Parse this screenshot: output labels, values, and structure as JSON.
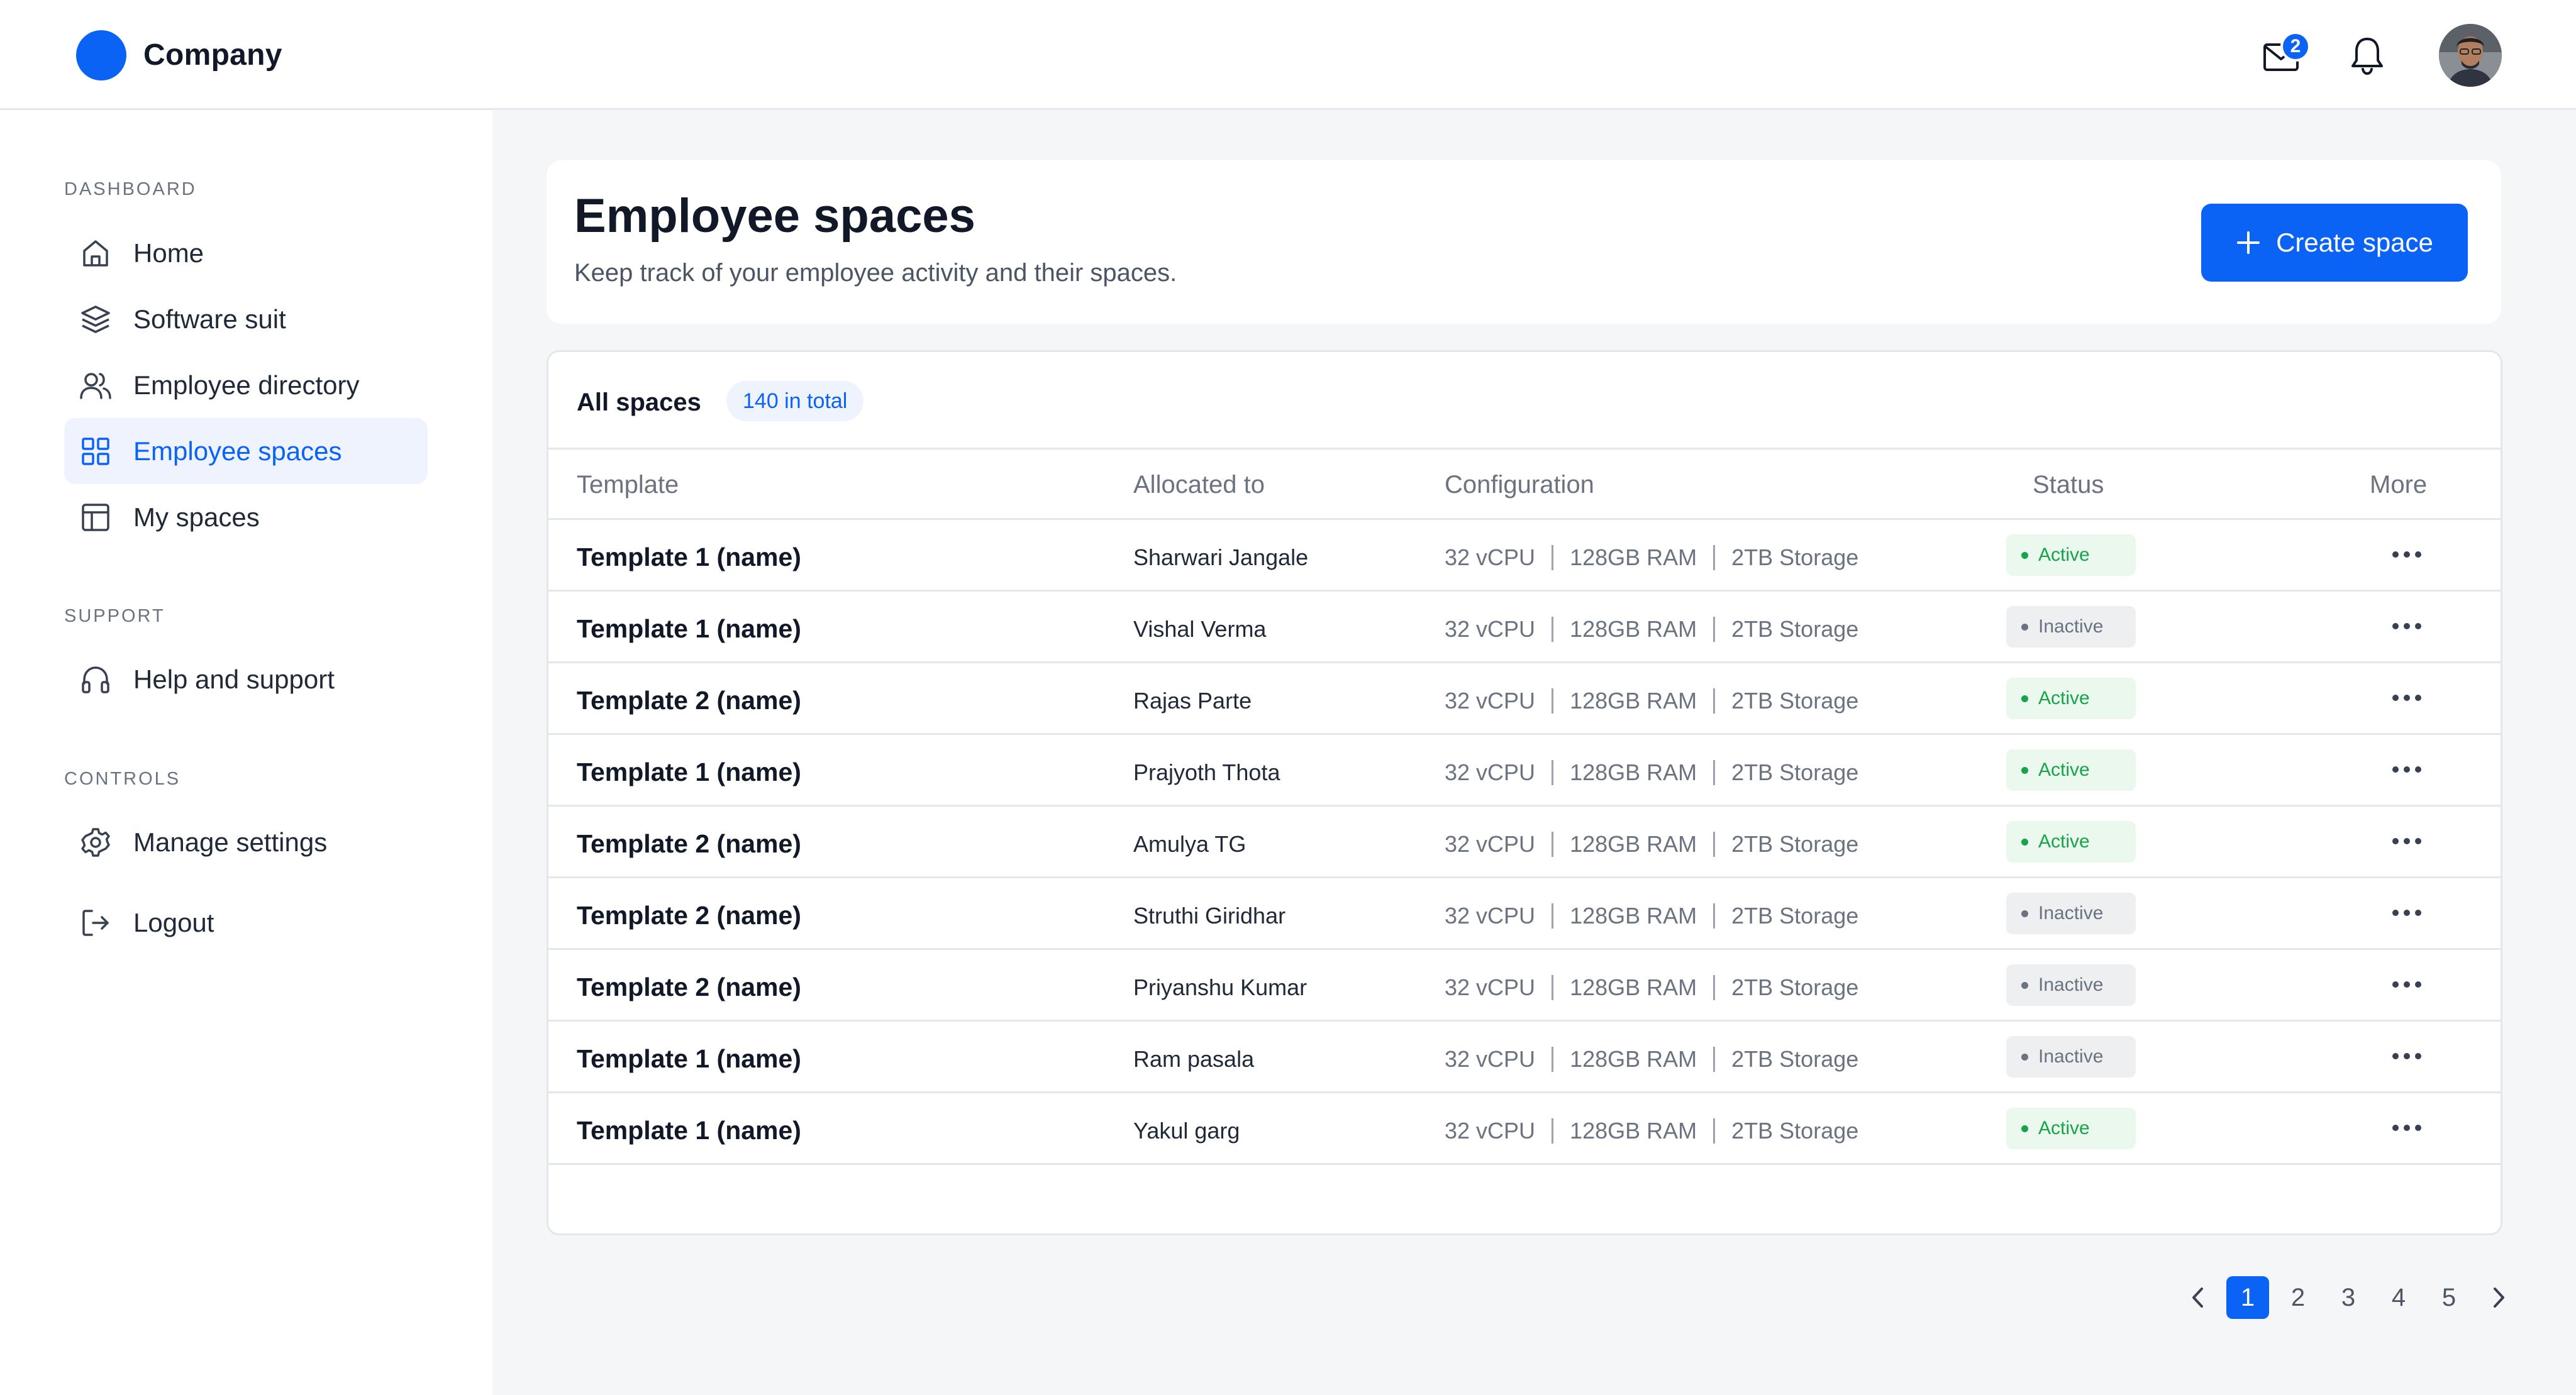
{
  "brand": {
    "name": "Company",
    "logo_color": "#0b63f6"
  },
  "topbar": {
    "mail_badge": "2"
  },
  "sidebar": {
    "sections": {
      "dashboard": "DASHBOARD",
      "support": "SUPPORT",
      "controls": "CONTROLS"
    },
    "items": [
      {
        "label": "Home",
        "icon": "home-icon"
      },
      {
        "label": "Software suit",
        "icon": "layers-icon"
      },
      {
        "label": "Employee directory",
        "icon": "users-icon"
      },
      {
        "label": "Employee spaces",
        "icon": "grid-icon",
        "active": true
      },
      {
        "label": "My spaces",
        "icon": "layout-icon"
      },
      {
        "label": "Help and support",
        "icon": "headphones-icon"
      },
      {
        "label": "Manage settings",
        "icon": "gear-icon"
      },
      {
        "label": "Logout",
        "icon": "logout-icon"
      }
    ]
  },
  "page": {
    "title": "Employee spaces",
    "subtitle": "Keep track of your employee activity and their spaces.",
    "create_label": "Create space"
  },
  "table": {
    "title": "All spaces",
    "total": "140 in total",
    "columns": [
      "Template",
      "Allocated to",
      "Configuration",
      "Status",
      "More"
    ],
    "rows": [
      {
        "template": "Template 1 (name)",
        "allocated": "Sharwari Jangale",
        "cpu": "32 vCPU",
        "ram": "128GB RAM",
        "storage": "2TB Storage",
        "status": "Active"
      },
      {
        "template": "Template 1 (name)",
        "allocated": "Vishal Verma",
        "cpu": "32 vCPU",
        "ram": "128GB RAM",
        "storage": "2TB Storage",
        "status": "Inactive"
      },
      {
        "template": "Template 2 (name)",
        "allocated": "Rajas Parte",
        "cpu": "32 vCPU",
        "ram": "128GB RAM",
        "storage": "2TB Storage",
        "status": "Active"
      },
      {
        "template": "Template 1 (name)",
        "allocated": "Prajyoth Thota",
        "cpu": "32 vCPU",
        "ram": "128GB RAM",
        "storage": "2TB Storage",
        "status": "Active"
      },
      {
        "template": "Template 2 (name)",
        "allocated": "Amulya TG",
        "cpu": "32 vCPU",
        "ram": "128GB RAM",
        "storage": "2TB Storage",
        "status": "Active"
      },
      {
        "template": "Template 2 (name)",
        "allocated": "Struthi Giridhar",
        "cpu": "32 vCPU",
        "ram": "128GB RAM",
        "storage": "2TB Storage",
        "status": "Inactive"
      },
      {
        "template": "Template 2 (name)",
        "allocated": "Priyanshu Kumar",
        "cpu": "32 vCPU",
        "ram": "128GB RAM",
        "storage": "2TB Storage",
        "status": "Inactive"
      },
      {
        "template": "Template 1 (name)",
        "allocated": "Ram pasala",
        "cpu": "32 vCPU",
        "ram": "128GB RAM",
        "storage": "2TB Storage",
        "status": "Inactive"
      },
      {
        "template": "Template 1 (name)",
        "allocated": "Yakul garg",
        "cpu": "32 vCPU",
        "ram": "128GB RAM",
        "storage": "2TB Storage",
        "status": "Active"
      }
    ]
  },
  "pagination": {
    "pages": [
      "1",
      "2",
      "3",
      "4",
      "5"
    ],
    "current": "1"
  },
  "colors": {
    "accent": "#0b63f6",
    "active": "#16a34a",
    "inactive": "#6b7280"
  }
}
